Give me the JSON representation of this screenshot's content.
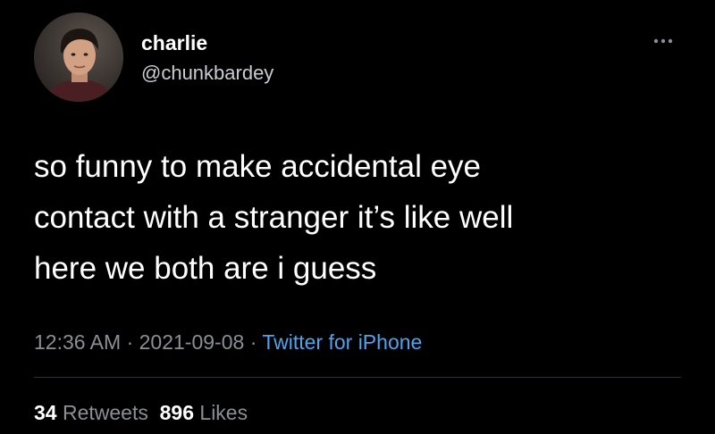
{
  "author": {
    "display_name": "charlie",
    "handle": "@chunkbardey"
  },
  "tweet": {
    "text_lines": [
      "so funny to make accidental eye",
      "contact with a stranger it’s like well",
      "here we both are i guess"
    ]
  },
  "meta": {
    "time": "12:36 AM",
    "separator": "·",
    "date": "2021-09-08",
    "source": "Twitter for iPhone"
  },
  "stats": {
    "retweets_count": "34",
    "retweets_label": "Retweets",
    "likes_count": "896",
    "likes_label": "Likes"
  },
  "icons": {
    "more": "more-horizontal-icon"
  },
  "colors": {
    "background": "#000000",
    "primary_text": "#ffffff",
    "secondary_text": "#8b8f94",
    "link": "#4ea3ef",
    "divider": "#2f3336"
  }
}
